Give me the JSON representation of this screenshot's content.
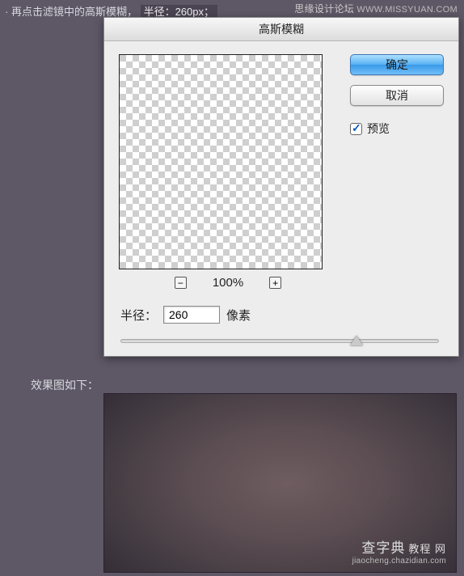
{
  "instruction": {
    "prefix": "· 再点击滤镜中的高斯模糊，",
    "radius_text": "半径：260px；"
  },
  "watermark_top": {
    "cn": "思缘设计论坛",
    "url": "WWW.MISSYUAN.COM"
  },
  "dialog": {
    "title": "高斯模糊",
    "ok_label": "确定",
    "cancel_label": "取消",
    "preview_label": "预览",
    "preview_checked": true,
    "zoom": {
      "minus": "⊟",
      "plus": "⊞",
      "percent": "100%"
    },
    "radius": {
      "label": "半径：",
      "value": "260",
      "unit": "像素"
    }
  },
  "result_label": "效果图如下：",
  "watermark_bottom": {
    "brand_main": "查字典",
    "brand_sub": "教程 网",
    "url": "jiaocheng.chazidian.com"
  },
  "chart_data": null
}
